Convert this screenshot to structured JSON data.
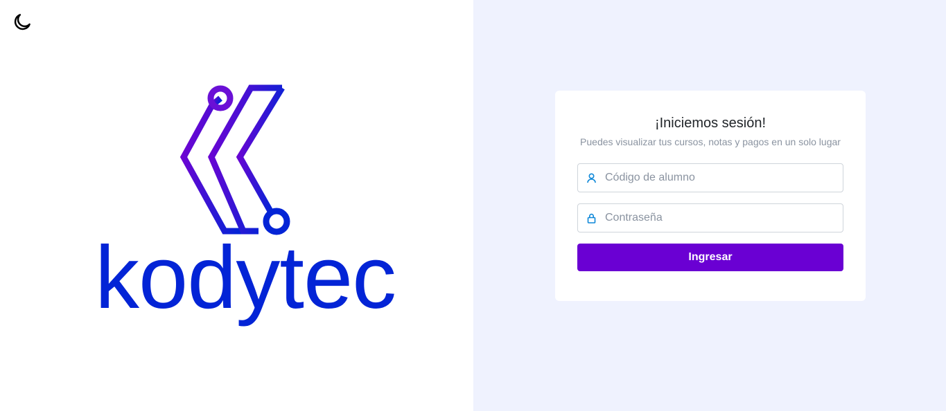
{
  "theme_toggle": {
    "icon": "moon-icon"
  },
  "brand": {
    "name": "kodytec",
    "colors": {
      "primary": "#0324d6",
      "secondary": "#6a00d3"
    }
  },
  "login": {
    "title": "¡Iniciemos sesión!",
    "subtitle": "Puedes visualizar tus cursos, notas y pagos en un solo lugar",
    "student_code": {
      "placeholder": "Código de alumno",
      "value": "",
      "icon": "user-icon"
    },
    "password": {
      "placeholder": "Contraseña",
      "value": "",
      "icon": "lock-icon"
    },
    "submit_label": "Ingresar",
    "accent": "#6a00d3",
    "background": "#eff2fe"
  }
}
